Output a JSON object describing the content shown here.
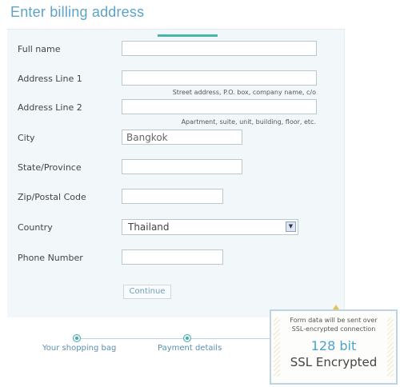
{
  "page": {
    "title": "Enter billing address"
  },
  "form": {
    "full_name": {
      "label": "Full name",
      "value": ""
    },
    "address1": {
      "label": "Address Line 1",
      "value": "",
      "hint": "Street address, P.O. box, company name, c/o"
    },
    "address2": {
      "label": "Address Line 2",
      "value": "",
      "hint": "Apartment, suite, unit, building, floor, etc."
    },
    "city": {
      "label": "City",
      "value": "Bangkok"
    },
    "state": {
      "label": "State/Province",
      "value": ""
    },
    "zip": {
      "label": "Zip/Postal Code",
      "value": ""
    },
    "country": {
      "label": "Country",
      "value": "Thailand"
    },
    "phone": {
      "label": "Phone Number",
      "value": ""
    },
    "continue_label": "Continue"
  },
  "steps": [
    {
      "label": "Your shopping bag",
      "active": false
    },
    {
      "label": "Payment details",
      "active": true
    }
  ],
  "ssl": {
    "note_line1": "Form data will be sent over",
    "note_line2": "SSL-encrypted connection",
    "bits": "128 bit",
    "label": "SSL Encrypted"
  },
  "colors": {
    "accent": "#5da3c8",
    "panel": "#f2f7fa",
    "step": "#46b3b1",
    "warning": "#e9c24d"
  },
  "icons": {
    "select_arrow": "chevron-down-icon",
    "warning": "warning-icon"
  }
}
